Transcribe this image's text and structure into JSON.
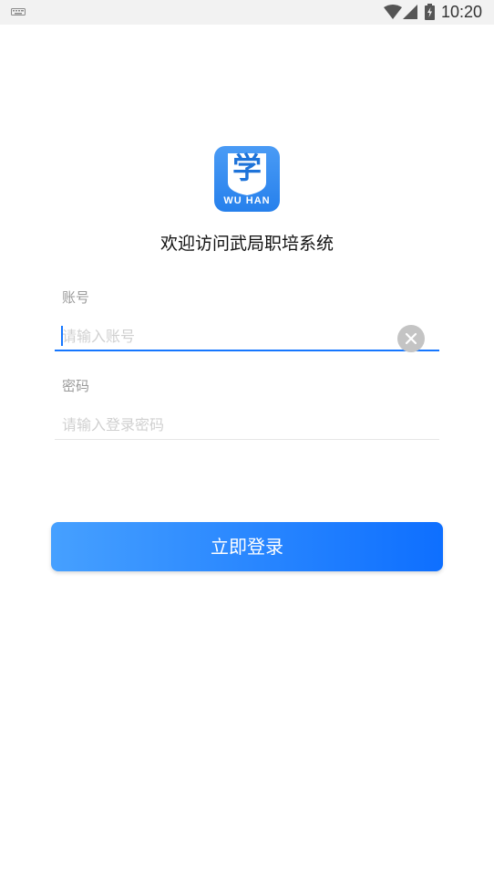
{
  "status_bar": {
    "time": "10:20",
    "icons": [
      "keyboard-icon",
      "wifi-icon",
      "signal-icon",
      "battery-icon"
    ]
  },
  "logo": {
    "char": "学",
    "text": "WU HAN",
    "color": "#2680ec"
  },
  "welcome_text": "欢迎访问武局职培系统",
  "account": {
    "label": "账号",
    "placeholder": "请输入账号",
    "value": "",
    "clear_icon": "clear-icon"
  },
  "password": {
    "label": "密码",
    "placeholder": "请输入登录密码",
    "value": ""
  },
  "login_button": {
    "label": "立即登录",
    "gradient_start": "#46a0ff",
    "gradient_end": "#0e6fff"
  }
}
